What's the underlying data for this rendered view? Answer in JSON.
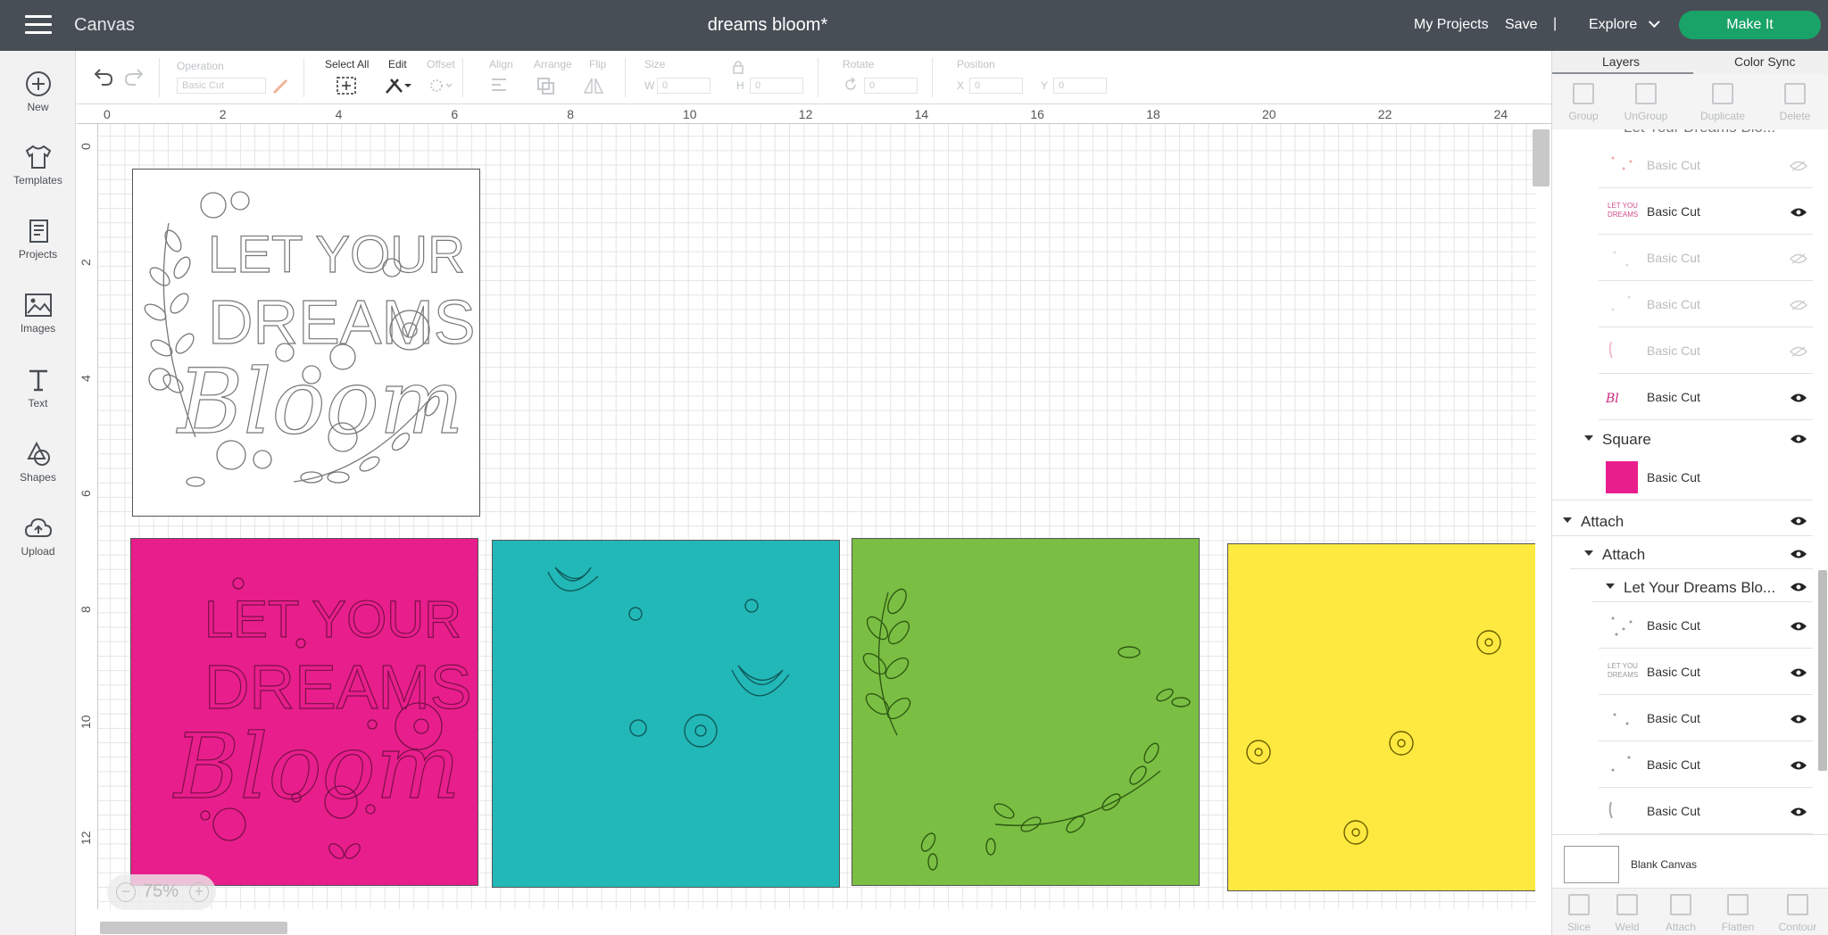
{
  "topbar": {
    "app_name": "Canvas",
    "doc_title": "dreams bloom*",
    "my_projects": "My Projects",
    "save": "Save",
    "separator": "|",
    "explore": "Explore",
    "make_it": "Make It",
    "bg_color": "#484e56",
    "make_it_color": "#1aa368"
  },
  "leftnav": {
    "items": [
      {
        "label": "New",
        "icon": "plus-circle-icon"
      },
      {
        "label": "Templates",
        "icon": "tshirt-icon"
      },
      {
        "label": "Projects",
        "icon": "projects-icon"
      },
      {
        "label": "Images",
        "icon": "image-icon"
      },
      {
        "label": "Text",
        "icon": "text-icon"
      },
      {
        "label": "Shapes",
        "icon": "shapes-icon"
      },
      {
        "label": "Upload",
        "icon": "upload-cloud-icon"
      }
    ]
  },
  "toolbar": {
    "operation_label": "Operation",
    "operation_value": "Basic Cut",
    "select_all": "Select All",
    "edit": "Edit",
    "offset": "Offset",
    "align": "Align",
    "arrange": "Arrange",
    "flip": "Flip",
    "size": "Size",
    "w": "W",
    "w_value": "0",
    "h": "H",
    "h_value": "0",
    "rotate": "Rotate",
    "rotate_value": "0",
    "position": "Position",
    "x": "X",
    "x_value": "0",
    "y": "Y",
    "y_value": "0"
  },
  "ruler": {
    "top": [
      "0",
      "2",
      "4",
      "6",
      "8",
      "10",
      "12",
      "14",
      "16",
      "18",
      "20",
      "22",
      "24"
    ],
    "left": [
      "0",
      "2",
      "4",
      "6",
      "8",
      "10",
      "12"
    ]
  },
  "canvas": {
    "zoom": "75%",
    "zoom_out": "−",
    "zoom_in": "+",
    "design_text": {
      "line1": "LET YOUR",
      "line2": "DREAMS",
      "line3": "Bloom"
    },
    "mats": [
      {
        "name": "white",
        "color": "#ffffff"
      },
      {
        "name": "pink",
        "color": "#e81e8c"
      },
      {
        "name": "teal",
        "color": "#22b8b7"
      },
      {
        "name": "green",
        "color": "#7abf43"
      },
      {
        "name": "yellow",
        "color": "#fde93f"
      }
    ]
  },
  "rpanel": {
    "tab_layers": "Layers",
    "tab_color_sync": "Color Sync",
    "actions_top": [
      "Group",
      "UnGroup",
      "Duplicate",
      "Delete"
    ],
    "actions_bottom": [
      "Slice",
      "Weld",
      "Attach",
      "Flatten",
      "Contour"
    ],
    "partial_group_label": "Let Your Dreams Blo...",
    "layers_upper": [
      {
        "label": "Basic Cut",
        "visible": false
      },
      {
        "label": "Basic Cut",
        "visible": true
      },
      {
        "label": "Basic Cut",
        "visible": false
      },
      {
        "label": "Basic Cut",
        "visible": false
      },
      {
        "label": "Basic Cut",
        "visible": false
      },
      {
        "label": "Basic Cut",
        "visible": true
      }
    ],
    "square_group": "Square",
    "square_layer": "Basic Cut",
    "square_color": "#e81e8c",
    "attach_outer": "Attach",
    "attach_inner": "Attach",
    "dreams_group": "Let Your Dreams Blo...",
    "layers_lower": [
      {
        "label": "Basic Cut",
        "visible": true
      },
      {
        "label": "Basic Cut",
        "visible": true
      },
      {
        "label": "Basic Cut",
        "visible": true
      },
      {
        "label": "Basic Cut",
        "visible": true
      },
      {
        "label": "Basic Cut",
        "visible": true
      }
    ],
    "blank_canvas": "Blank Canvas"
  }
}
